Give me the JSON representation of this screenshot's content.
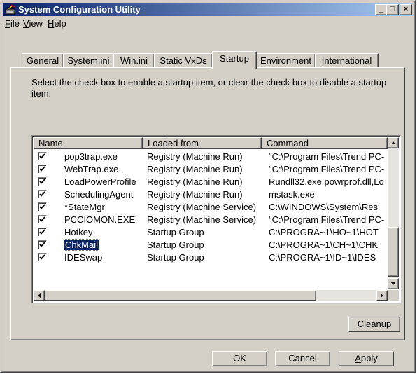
{
  "window": {
    "title": "System Configuration Utility",
    "minimize": "_",
    "maximize": "□",
    "close": "×"
  },
  "menu": [
    {
      "accel": "F",
      "rest": "ile"
    },
    {
      "accel": "V",
      "rest": "iew"
    },
    {
      "accel": "H",
      "rest": "elp"
    }
  ],
  "tabs": [
    "General",
    "System.ini",
    "Win.ini",
    "Static VxDs",
    "Startup",
    "Environment",
    "International"
  ],
  "active_tab": "Startup",
  "description": "Select the check box to enable a startup item, or clear the check box to disable a startup item.",
  "columns": [
    "Name",
    "Loaded from",
    "Command"
  ],
  "rows": [
    {
      "name": "pop3trap.exe",
      "loaded_from": "Registry (Machine Run)",
      "command": "\"C:\\Program Files\\Trend PC-",
      "checked": true
    },
    {
      "name": "WebTrap.exe",
      "loaded_from": "Registry (Machine Run)",
      "command": "\"C:\\Program Files\\Trend PC-",
      "checked": true
    },
    {
      "name": "LoadPowerProfile",
      "loaded_from": "Registry (Machine Run)",
      "command": "Rundll32.exe powrprof.dll,Lo",
      "checked": true
    },
    {
      "name": "SchedulingAgent",
      "loaded_from": "Registry (Machine Run)",
      "command": "mstask.exe",
      "checked": true
    },
    {
      "name": "*StateMgr",
      "loaded_from": "Registry (Machine Service)",
      "command": "C:\\WINDOWS\\System\\Res",
      "checked": true
    },
    {
      "name": "PCCIOMON.EXE",
      "loaded_from": "Registry (Machine Service)",
      "command": "\"C:\\Program Files\\Trend PC-",
      "checked": true
    },
    {
      "name": "Hotkey",
      "loaded_from": "Startup Group",
      "command": "C:\\PROGRA~1\\HO~1\\HOT",
      "checked": true
    },
    {
      "name": "ChkMail",
      "loaded_from": "Startup Group",
      "command": "C:\\PROGRA~1\\CH~1\\CHK",
      "checked": true,
      "selected": true
    },
    {
      "name": "IDESwap",
      "loaded_from": "Startup Group",
      "command": "C:\\PROGRA~1\\ID~1\\IDES",
      "checked": true
    }
  ],
  "buttons": {
    "cleanup": {
      "accel": "C",
      "rest": "leanup"
    },
    "ok": "OK",
    "cancel": "Cancel",
    "apply": {
      "accel": "A",
      "rest": "pply"
    }
  }
}
